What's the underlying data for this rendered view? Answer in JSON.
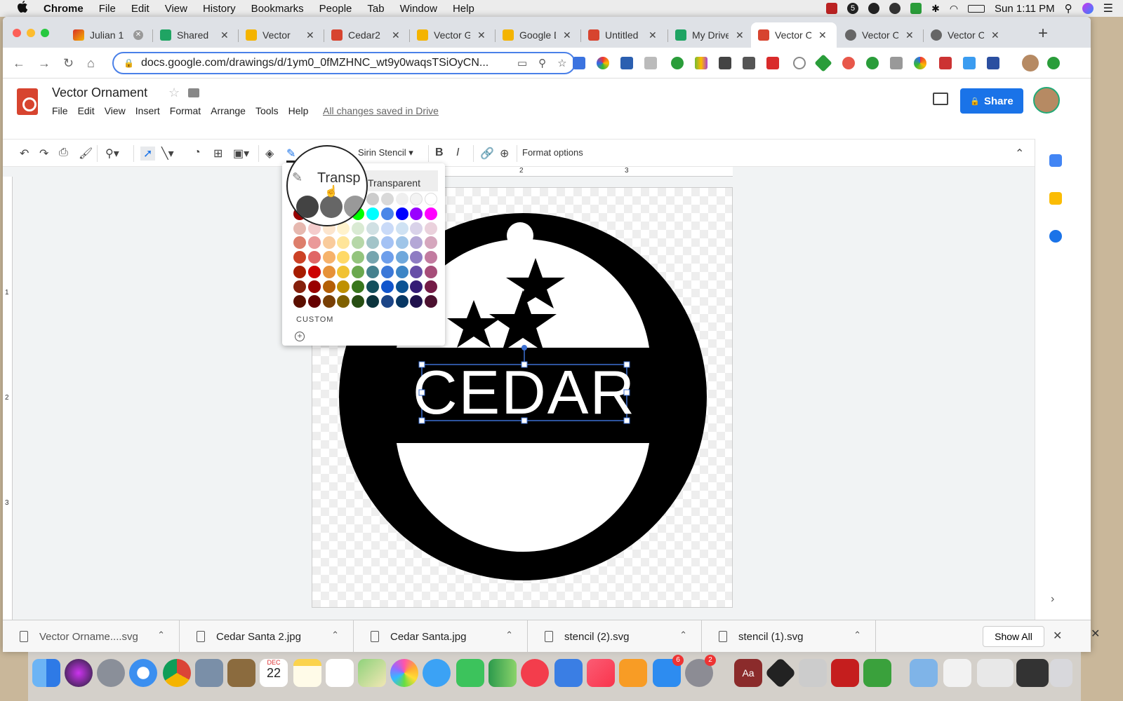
{
  "menubar": {
    "apple": "",
    "app": "Chrome",
    "items": [
      "File",
      "Edit",
      "View",
      "History",
      "Bookmarks",
      "People",
      "Tab",
      "Window",
      "Help"
    ],
    "clock": "Sun 1:11 PM",
    "badge_count": "5"
  },
  "tabs": [
    {
      "label": "Julian 1",
      "icon": "julian-icon",
      "color": "#d93025"
    },
    {
      "label": "Shared",
      "icon": "drive-icon",
      "color": "#1fa463"
    },
    {
      "label": "Vector",
      "icon": "slides-icon",
      "color": "#f4b400"
    },
    {
      "label": "Cedar2",
      "icon": "drawings-icon",
      "color": "#d7442f"
    },
    {
      "label": "Vector G",
      "icon": "slides-icon",
      "color": "#f4b400"
    },
    {
      "label": "Google D",
      "icon": "slides-icon",
      "color": "#f4b400"
    },
    {
      "label": "Untitled",
      "icon": "drawings-icon",
      "color": "#d7442f"
    },
    {
      "label": "My Drive",
      "icon": "drive-icon",
      "color": "#1fa463"
    },
    {
      "label": "Vector O",
      "icon": "drawings-icon",
      "color": "#d7442f",
      "active": true
    },
    {
      "label": "Vector O",
      "icon": "globe-icon",
      "color": "#666666"
    },
    {
      "label": "Vector O",
      "icon": "globe-icon",
      "color": "#666666"
    }
  ],
  "addressbar": {
    "url": "docs.google.com/drawings/d/1ym0_0fMZHNC_wt9y0waqsTSiOyCN..."
  },
  "document": {
    "title": "Vector Ornament",
    "menu": [
      "File",
      "Edit",
      "View",
      "Insert",
      "Format",
      "Arrange",
      "Tools",
      "Help"
    ],
    "save_status": "All changes saved in Drive",
    "share_label": "Share"
  },
  "toolbar": {
    "font": "Sirin Stencil",
    "format_options": "Format options"
  },
  "rulers": {
    "h_marks": [
      "2",
      "3"
    ],
    "v_marks": [
      "1",
      "2",
      "3"
    ]
  },
  "canvas": {
    "text": "CEDAR"
  },
  "palette": {
    "transparent_label": "Transparent",
    "magnified_label": "Transp",
    "custom_label": "CUSTOM",
    "grays": [
      "#000000",
      "#434343",
      "#666666",
      "#999999",
      "#b7b7b7",
      "#cccccc",
      "#d9d9d9",
      "#efefef",
      "#f3f3f3",
      "#ffffff"
    ],
    "brights": [
      "#980000",
      "#ff0000",
      "#ff9900",
      "#ffff00",
      "#00ff00",
      "#00ffff",
      "#4a86e8",
      "#0000ff",
      "#9900ff",
      "#ff00ff"
    ],
    "shades": [
      [
        "#e6b8af",
        "#f4cccc",
        "#fce5cd",
        "#fff2cc",
        "#d9ead3",
        "#d0e0e3",
        "#c9daf8",
        "#cfe2f3",
        "#d9d2e9",
        "#ead1dc"
      ],
      [
        "#dd7e6b",
        "#ea9999",
        "#f9cb9c",
        "#ffe599",
        "#b6d7a8",
        "#a2c4c9",
        "#a4c2f4",
        "#9fc5e8",
        "#b4a7d6",
        "#d5a6bd"
      ],
      [
        "#cc4125",
        "#e06666",
        "#f6b26b",
        "#ffd966",
        "#93c47d",
        "#76a5af",
        "#6d9eeb",
        "#6fa8dc",
        "#8e7cc3",
        "#c27ba0"
      ],
      [
        "#a61c00",
        "#cc0000",
        "#e69138",
        "#f1c232",
        "#6aa84f",
        "#45818e",
        "#3c78d8",
        "#3d85c6",
        "#674ea7",
        "#a64d79"
      ],
      [
        "#85200c",
        "#990000",
        "#b45f06",
        "#bf9000",
        "#38761d",
        "#134f5c",
        "#1155cc",
        "#0b5394",
        "#351c75",
        "#741b47"
      ],
      [
        "#5b0f00",
        "#660000",
        "#783f04",
        "#7f6000",
        "#274e13",
        "#0c343d",
        "#1c4587",
        "#073763",
        "#20124d",
        "#4c1130"
      ]
    ]
  },
  "downloads": [
    {
      "name": "Vector Orname....svg"
    },
    {
      "name": "Cedar Santa 2.jpg"
    },
    {
      "name": "Cedar Santa.jpg"
    },
    {
      "name": "stencil (2).svg"
    },
    {
      "name": "stencil (1).svg"
    }
  ],
  "downloads_show_all": "Show All",
  "dock": {
    "calendar_month": "DEC",
    "calendar_day": "22",
    "appstore_badge": "6",
    "prefs_badge": "2",
    "dictionary_label": "Aa"
  }
}
